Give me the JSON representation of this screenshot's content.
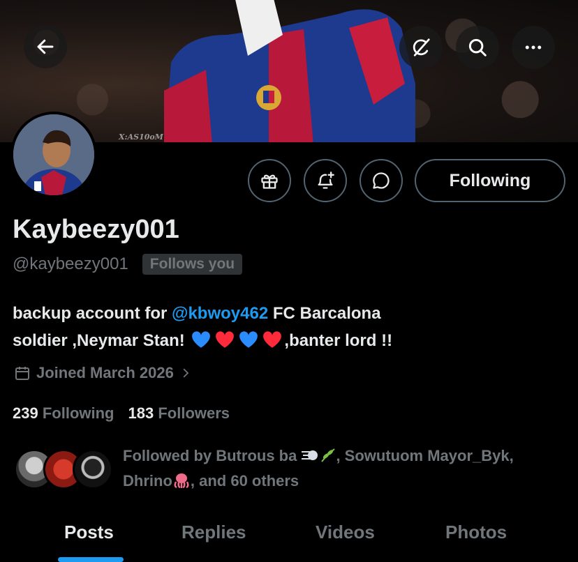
{
  "banner": {
    "watermark": "X:AS10oM"
  },
  "header": {
    "back_icon": "arrow-left-icon",
    "grok_icon": "grok-icon",
    "search_icon": "search-icon",
    "more_icon": "more-horizontal-icon"
  },
  "profile": {
    "display_name": "Kaybeezy001",
    "handle": "@kaybeezy001",
    "follows_you_badge": "Follows you",
    "following_button_label": "Following",
    "action_icons": [
      "gift-icon",
      "bell-plus-icon",
      "message-icon"
    ],
    "bio": {
      "prefix": "backup account for ",
      "mention": "@kbwoy462",
      "suffix_line1": " FC Barcalona",
      "line2_start": "soldier ,Neymar Stan! ",
      "line2_end": ",banter lord !!",
      "emojis": [
        "blue-heart",
        "red-heart",
        "blue-heart",
        "red-heart"
      ]
    },
    "joined": "Joined March 2026",
    "stats": {
      "following_count": "239",
      "following_label": "Following",
      "followers_count": "183",
      "followers_label": "Followers"
    },
    "followed_by": {
      "text1": "Followed by Butrous ba ",
      "text2": ", Sowutuom Mayor_Byk,",
      "text3": "Dhrino",
      "text4": ", and 60 others"
    }
  },
  "tabs": [
    {
      "label": "Posts",
      "active": true
    },
    {
      "label": "Replies",
      "active": false
    },
    {
      "label": "Videos",
      "active": false
    },
    {
      "label": "Photos",
      "active": false
    }
  ],
  "colors": {
    "accent": "#1d9bf0",
    "muted": "#71767b",
    "border": "#536471",
    "text": "#e7e9ea",
    "blue_heart": "#2a8cff",
    "red_heart": "#ff2a3a"
  }
}
